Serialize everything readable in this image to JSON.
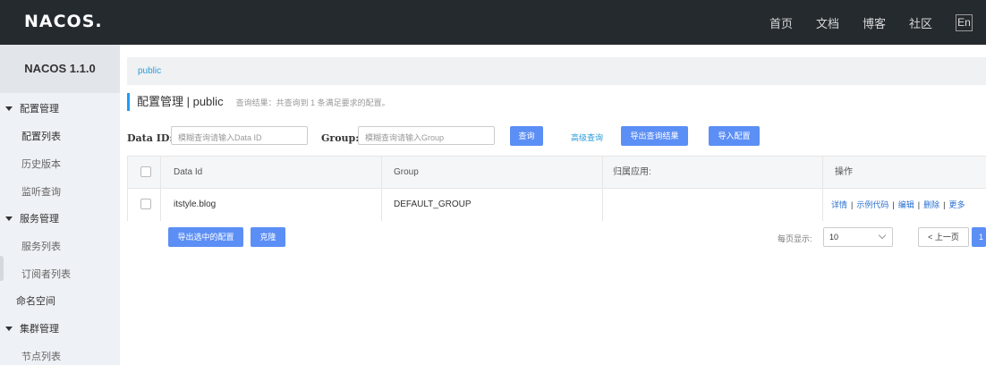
{
  "app": {
    "logo": "NACOS.",
    "version": "NACOS 1.1.0"
  },
  "topnav": {
    "items": [
      "首页",
      "文档",
      "博客",
      "社区"
    ],
    "lang": "En"
  },
  "sidebar": {
    "groups": [
      {
        "label": "配置管理",
        "items": [
          "配置列表",
          "历史版本",
          "监听查询"
        ]
      },
      {
        "label": "服务管理",
        "items": [
          "服务列表",
          "订阅者列表"
        ]
      }
    ],
    "namespace": "命名空间",
    "cluster": {
      "label": "集群管理",
      "items": [
        "节点列表"
      ]
    }
  },
  "breadcrumb": "public",
  "header": {
    "title": "配置管理 | public",
    "hint": "查询结果：共查询到 1 条满足要求的配置。"
  },
  "filters": {
    "data_id_label": "Data ID:",
    "data_id_placeholder": "模糊查询请输入Data ID",
    "group_label": "Group:",
    "group_placeholder": "模糊查询请输入Group",
    "query_button": "查询",
    "advanced_query": "高级查询",
    "export_results": "导出查询结果",
    "import_config": "导入配置"
  },
  "table": {
    "columns": [
      "Data Id",
      "Group",
      "归属应用:",
      "操作"
    ],
    "rows": [
      {
        "data_id": "itstyle.blog",
        "group": "DEFAULT_GROUP",
        "app": "",
        "ops": [
          "详情",
          "示例代码",
          "编辑",
          "删除",
          "更多"
        ]
      }
    ]
  },
  "footer": {
    "export_selected": "导出选中的配置",
    "clone": "克隆",
    "page_size_label": "每页显示:",
    "page_size": "10",
    "prev": "< 上一页",
    "current_page": "1"
  },
  "colors": {
    "topbar": "#252a2f",
    "sidebar": "#eef1f5",
    "primary": "#5c8ff5",
    "link": "#2b9bd8",
    "accent_bar": "#209bfa"
  }
}
